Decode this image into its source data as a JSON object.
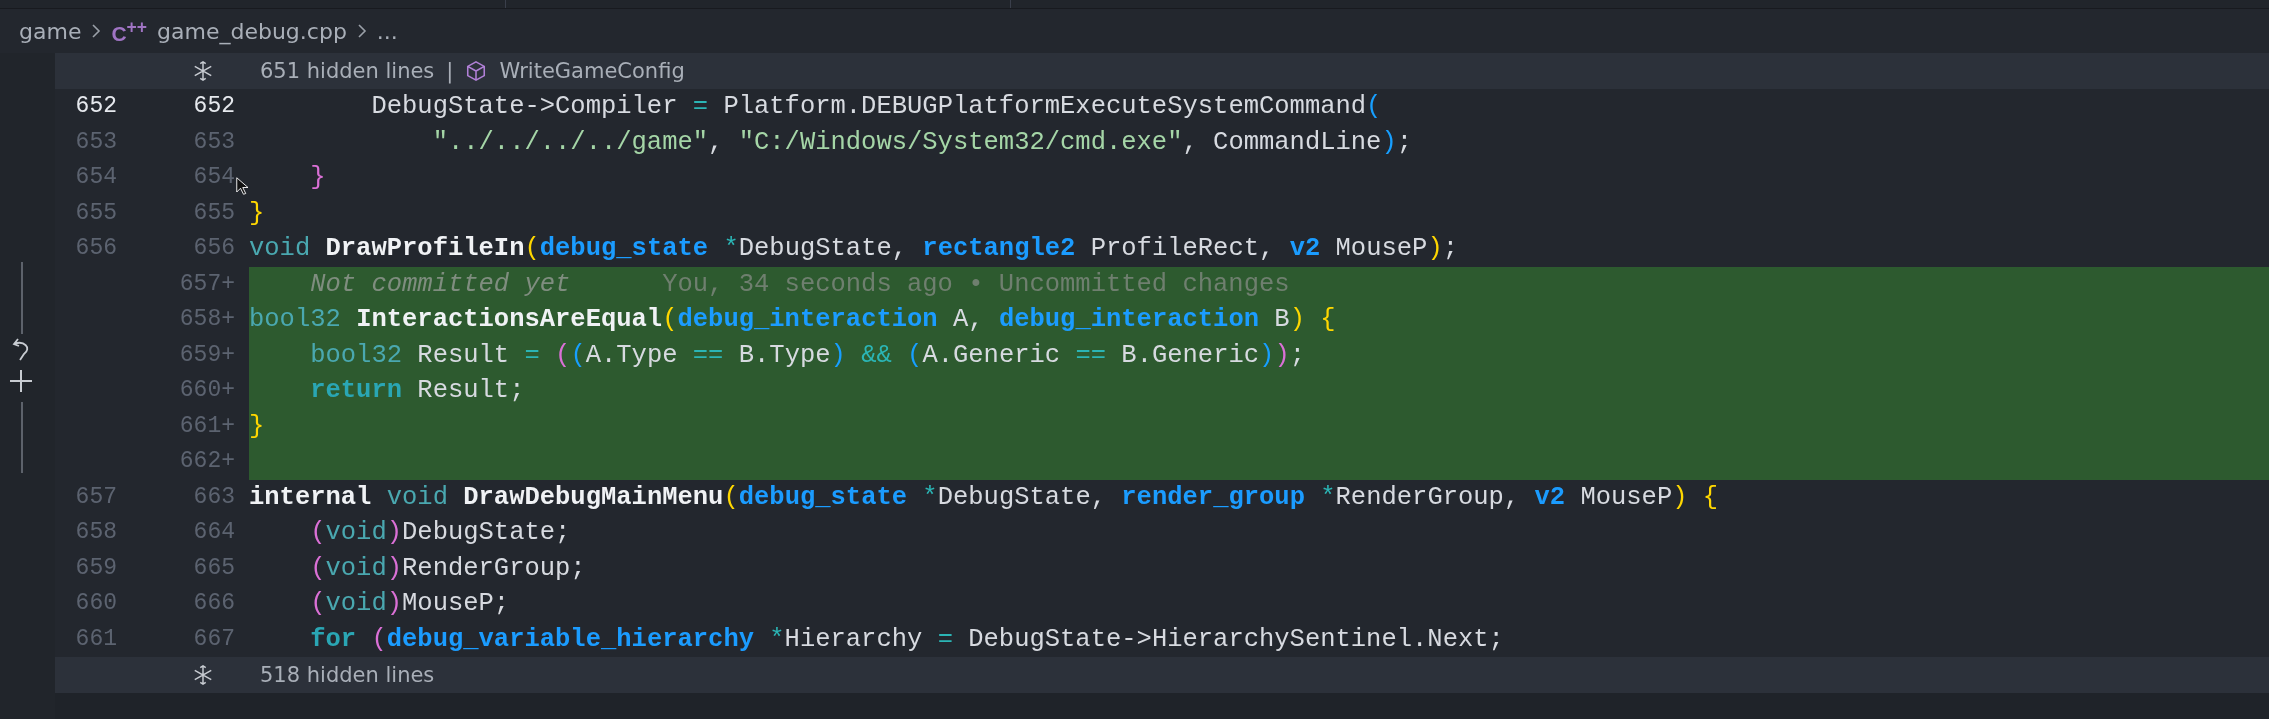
{
  "breadcrumb": {
    "folder": "game",
    "file_icon": "C$^{++}$",
    "file": "game_debug.cpp",
    "more": "..."
  },
  "top_fold": {
    "text": "651 hidden lines",
    "separator": "|",
    "symbol": "WriteGameConfig"
  },
  "lines": [
    {
      "old": "652",
      "new": "652",
      "current": true,
      "added": false,
      "tokens": [
        {
          "kind": "plain",
          "text": "        DebugState->Compiler "
        },
        {
          "kind": "op",
          "text": "="
        },
        {
          "kind": "plain",
          "text": " Platform.DEBUGPlatformExecuteSystemCommand"
        },
        {
          "kind": "brace3",
          "text": "("
        }
      ]
    },
    {
      "old": "653",
      "new": "653",
      "current": false,
      "added": false,
      "tokens": [
        {
          "kind": "string",
          "text": "            \"../../../../game\""
        },
        {
          "kind": "plain",
          "text": ", "
        },
        {
          "kind": "string",
          "text": "\"C:/Windows/System32/cmd.exe\""
        },
        {
          "kind": "plain",
          "text": ", CommandLine"
        },
        {
          "kind": "brace3",
          "text": ")"
        },
        {
          "kind": "plain",
          "text": ";"
        }
      ]
    },
    {
      "old": "654",
      "new": "654",
      "current": false,
      "added": false,
      "tokens": [
        {
          "kind": "brace2",
          "text": "    }"
        }
      ]
    },
    {
      "old": "655",
      "new": "655",
      "current": false,
      "added": false,
      "tokens": [
        {
          "kind": "brace1",
          "text": "}"
        }
      ]
    },
    {
      "old": "656",
      "new": "656",
      "current": false,
      "added": false,
      "tokens": [
        {
          "kind": "keyword",
          "text": "void "
        },
        {
          "kind": "func",
          "text": "DrawProfileIn"
        },
        {
          "kind": "brace1",
          "text": "("
        },
        {
          "kind": "type",
          "text": "debug_state "
        },
        {
          "kind": "op",
          "text": "*"
        },
        {
          "kind": "plain",
          "text": "DebugState, "
        },
        {
          "kind": "type",
          "text": "rectangle2"
        },
        {
          "kind": "plain",
          "text": " ProfileRect, "
        },
        {
          "kind": "type",
          "text": "v2"
        },
        {
          "kind": "plain",
          "text": " MouseP"
        },
        {
          "kind": "brace1",
          "text": ")"
        },
        {
          "kind": "plain",
          "text": ";"
        }
      ]
    },
    {
      "new": "657+",
      "current": false,
      "added": true,
      "tokens": [
        {
          "kind": "blame-note",
          "text": "    Not committed yet"
        },
        {
          "kind": "blame",
          "text": "      You, 34 seconds ago • Uncommitted changes"
        }
      ]
    },
    {
      "new": "658+",
      "current": false,
      "added": true,
      "tokens": [
        {
          "kind": "keyword",
          "text": "bool32 "
        },
        {
          "kind": "func",
          "text": "InteractionsAreEqual"
        },
        {
          "kind": "brace1",
          "text": "("
        },
        {
          "kind": "type",
          "text": "debug_interaction"
        },
        {
          "kind": "plain",
          "text": " A, "
        },
        {
          "kind": "type",
          "text": "debug_interaction"
        },
        {
          "kind": "plain",
          "text": " B"
        },
        {
          "kind": "brace1",
          "text": ") {"
        }
      ]
    },
    {
      "new": "659+",
      "current": false,
      "added": true,
      "tokens": [
        {
          "kind": "keyword",
          "text": "    bool32"
        },
        {
          "kind": "plain",
          "text": " Result "
        },
        {
          "kind": "op",
          "text": "= "
        },
        {
          "kind": "brace2",
          "text": "("
        },
        {
          "kind": "brace3",
          "text": "("
        },
        {
          "kind": "plain",
          "text": "A.Type "
        },
        {
          "kind": "op",
          "text": "=="
        },
        {
          "kind": "plain",
          "text": " B.Type"
        },
        {
          "kind": "brace3",
          "text": ") "
        },
        {
          "kind": "op",
          "text": "&& "
        },
        {
          "kind": "brace3",
          "text": "("
        },
        {
          "kind": "plain",
          "text": "A.Generic "
        },
        {
          "kind": "op",
          "text": "=="
        },
        {
          "kind": "plain",
          "text": " B.Generic"
        },
        {
          "kind": "brace3",
          "text": ")"
        },
        {
          "kind": "brace2",
          "text": ")"
        },
        {
          "kind": "plain",
          "text": ";"
        }
      ]
    },
    {
      "new": "660+",
      "current": false,
      "added": true,
      "tokens": [
        {
          "kind": "keyword-bold",
          "text": "    return"
        },
        {
          "kind": "plain",
          "text": " Result;"
        }
      ]
    },
    {
      "new": "661+",
      "current": false,
      "added": true,
      "tokens": [
        {
          "kind": "brace1",
          "text": "}"
        }
      ]
    },
    {
      "new": "662+",
      "current": false,
      "added": true
    },
    {
      "old": "657",
      "new": "663",
      "current": false,
      "added": false,
      "tokens": [
        {
          "kind": "func",
          "text": "internal "
        },
        {
          "kind": "keyword",
          "text": "void "
        },
        {
          "kind": "func",
          "text": "DrawDebugMainMenu"
        },
        {
          "kind": "brace1",
          "text": "("
        },
        {
          "kind": "type",
          "text": "debug_state "
        },
        {
          "kind": "op",
          "text": "*"
        },
        {
          "kind": "plain",
          "text": "DebugState, "
        },
        {
          "kind": "type",
          "text": "render_group "
        },
        {
          "kind": "op",
          "text": "*"
        },
        {
          "kind": "plain",
          "text": "RenderGroup, "
        },
        {
          "kind": "type",
          "text": "v2"
        },
        {
          "kind": "plain",
          "text": " MouseP"
        },
        {
          "kind": "brace1",
          "text": ") {"
        }
      ]
    },
    {
      "old": "658",
      "new": "664",
      "current": false,
      "added": false,
      "tokens": [
        {
          "kind": "brace2",
          "text": "    ("
        },
        {
          "kind": "keyword",
          "text": "void"
        },
        {
          "kind": "brace2",
          "text": ")"
        },
        {
          "kind": "plain",
          "text": "DebugState;"
        }
      ]
    },
    {
      "old": "659",
      "new": "665",
      "current": false,
      "added": false,
      "tokens": [
        {
          "kind": "brace2",
          "text": "    ("
        },
        {
          "kind": "keyword",
          "text": "void"
        },
        {
          "kind": "brace2",
          "text": ")"
        },
        {
          "kind": "plain",
          "text": "RenderGroup;"
        }
      ]
    },
    {
      "old": "660",
      "new": "666",
      "current": false,
      "added": false,
      "tokens": [
        {
          "kind": "brace2",
          "text": "    ("
        },
        {
          "kind": "keyword",
          "text": "void"
        },
        {
          "kind": "brace2",
          "text": ")"
        },
        {
          "kind": "plain",
          "text": "MouseP;"
        }
      ]
    },
    {
      "old": "661",
      "new": "667",
      "current": false,
      "added": false,
      "tokens": [
        {
          "kind": "keyword-bold",
          "text": "    for "
        },
        {
          "kind": "brace2",
          "text": "("
        },
        {
          "kind": "type",
          "text": "debug_variable_hierarchy "
        },
        {
          "kind": "op",
          "text": "*"
        },
        {
          "kind": "plain",
          "text": "Hierarchy "
        },
        {
          "kind": "op",
          "text": "="
        },
        {
          "kind": "plain",
          "text": " DebugState->HierarchySentinel.Next;"
        }
      ]
    }
  ],
  "bottom_fold": {
    "text": "518 hidden lines"
  }
}
